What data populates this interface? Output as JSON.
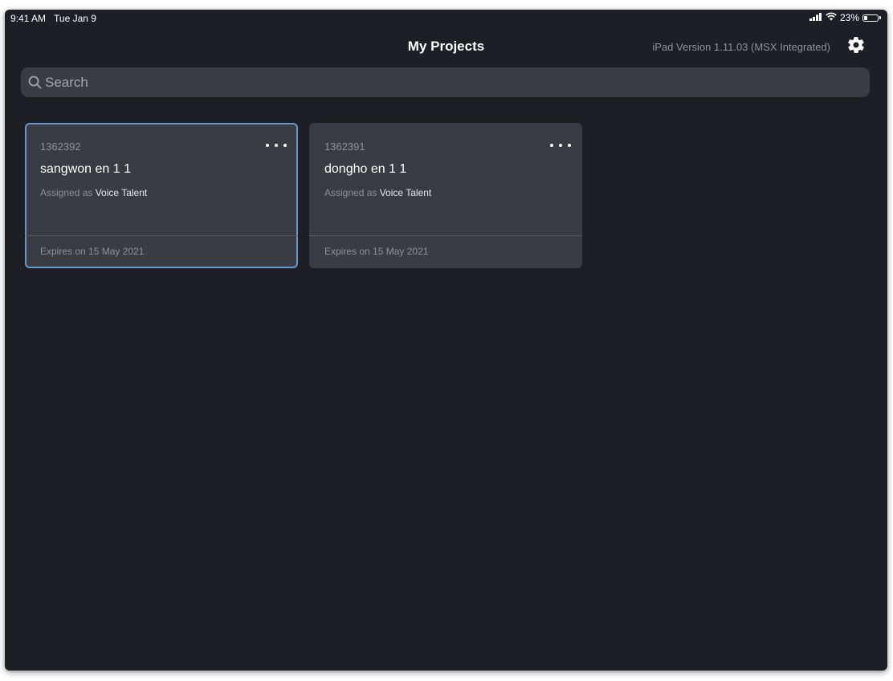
{
  "status_bar": {
    "time": "9:41 AM",
    "date": "Tue Jan 9",
    "battery": "23%",
    "battery_level": 0.23
  },
  "header": {
    "title": "My Projects",
    "version": "iPad Version 1.11.03 (MSX Integrated)",
    "settings_icon": "gear-icon"
  },
  "search": {
    "placeholder": "Search",
    "value": ""
  },
  "projects": [
    {
      "id": "1362392",
      "name": "sangwon en 1 1",
      "assigned_prefix": "Assigned as",
      "role": "Voice Talent",
      "expiry": "Expires on 15 May 2021",
      "selected": true
    },
    {
      "id": "1362391",
      "name": "dongho en 1 1",
      "assigned_prefix": "Assigned as",
      "role": "Voice Talent",
      "expiry": "Expires on 15 May 2021",
      "selected": false
    }
  ],
  "colors": {
    "background": "#1d1f25",
    "card": "#3a3c43",
    "selected_border": "#6c95c9",
    "muted_text": "#8e9199"
  }
}
